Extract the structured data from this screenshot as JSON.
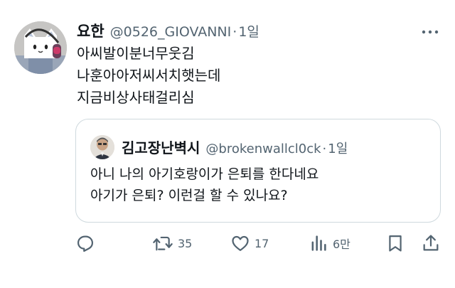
{
  "tweet": {
    "author": {
      "name": "요한",
      "handle": "@0526_GIOVANNI",
      "time": "1일"
    },
    "body_lines": [
      "아씨발이분너무웃김",
      "나훈아아저씨서치햇는데",
      "지금비상사태걸리심"
    ],
    "quote": {
      "author": {
        "name": "김고장난벽시",
        "handle": "@brokenwallcl0ck",
        "time": "1일"
      },
      "body_lines": [
        "아니 나의 아기호랑이가 은퇴를 한다네요",
        "아기가 은퇴? 이런걸 할 수 있나요?"
      ]
    },
    "actions": {
      "reply": {
        "icon": "reply-icon",
        "count": ""
      },
      "retweet": {
        "icon": "retweet-icon",
        "count": "35"
      },
      "like": {
        "icon": "heart-icon",
        "count": "17"
      },
      "views": {
        "icon": "views-icon",
        "count": "6만"
      },
      "bookmark": {
        "icon": "bookmark-icon"
      },
      "share": {
        "icon": "share-icon"
      }
    },
    "more_icon": "more-dots-icon",
    "colors": {
      "text": "#0f1419",
      "secondary": "#536471",
      "border": "#cfd9de"
    }
  }
}
